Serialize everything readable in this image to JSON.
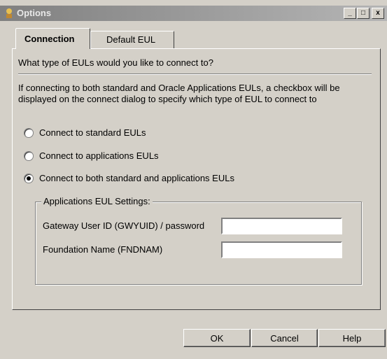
{
  "window": {
    "title": "Options"
  },
  "titlebar_buttons": {
    "minimize": "_",
    "maximize": "□",
    "close": "x"
  },
  "tabs": [
    {
      "label": "Connection",
      "active": true
    },
    {
      "label": "Default EUL",
      "active": false
    }
  ],
  "connection": {
    "question": "What type of EULs would you like to connect to?",
    "info": "If connecting to both standard and Oracle Applications EULs, a checkbox will be displayed on the connect dialog to specify which type of EUL to connect to",
    "options": [
      {
        "label": "Connect to standard EULs",
        "selected": false
      },
      {
        "label": "Connect to applications EULs",
        "selected": false
      },
      {
        "label": "Connect to both standard and applications EULs",
        "selected": true
      }
    ],
    "group": {
      "legend": "Applications EUL Settings:",
      "gateway_label": "Gateway User ID (GWYUID) / password",
      "gateway_value": "",
      "foundation_label": "Foundation Name (FNDNAM)",
      "foundation_value": ""
    }
  },
  "buttons": {
    "ok": "OK",
    "cancel": "Cancel",
    "help": "Help"
  }
}
